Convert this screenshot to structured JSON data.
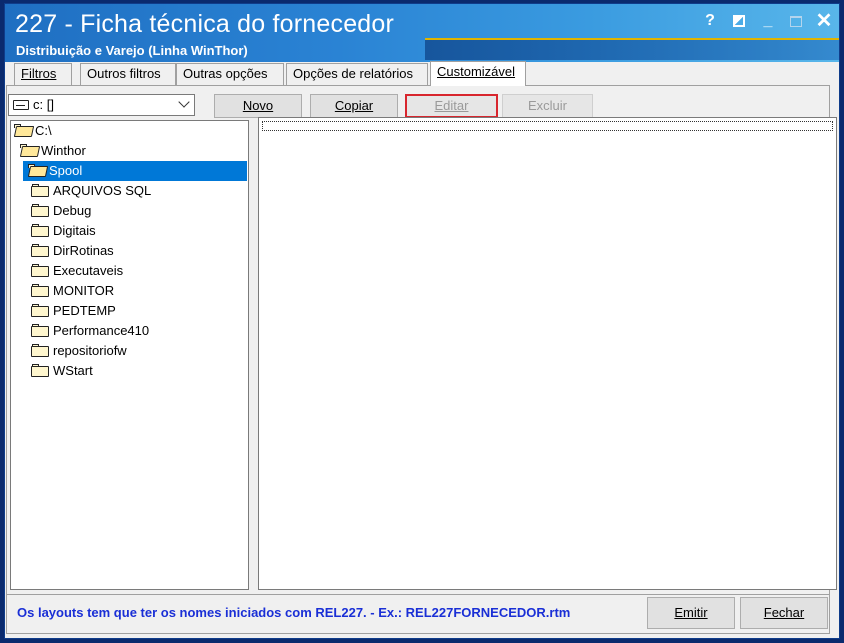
{
  "window": {
    "title": "227 - Ficha técnica do fornecedor",
    "subtitle": "Distribuição e Varejo (Linha WinThor)",
    "controls": {
      "help": "?",
      "minimize": "_",
      "close": "✕"
    }
  },
  "tabs": [
    {
      "label": "Filtros",
      "active": false
    },
    {
      "label": "Outros filtros",
      "active": false
    },
    {
      "label": "Outras opções",
      "active": false
    },
    {
      "label": "Opções de relatórios",
      "active": false
    },
    {
      "label": "Customizável",
      "active": true
    }
  ],
  "toolbar": {
    "drive_value": "c: []",
    "novo": "Novo",
    "copiar": "Copiar",
    "editar": "Editar",
    "excluir": "Excluir"
  },
  "tree": {
    "root": "C:\\",
    "level1": "Winthor",
    "selected": "Spool",
    "children": [
      "ARQUIVOS SQL",
      "Debug",
      "Digitais",
      "DirRotinas",
      "Executaveis",
      "MONITOR",
      "PEDTEMP",
      "Performance410",
      "repositoriofw",
      "WStart"
    ]
  },
  "footer": {
    "note": "Os layouts tem que ter os nomes iniciados com REL227.  - Ex.: REL227FORNECEDOR.rtm",
    "emitir": "Emitir",
    "fechar": "Fechar"
  },
  "colors": {
    "title_bar": "#2a83d4",
    "selection": "#0078d7",
    "note_text": "#1a2fd6",
    "highlight_border": "#d8262e"
  }
}
